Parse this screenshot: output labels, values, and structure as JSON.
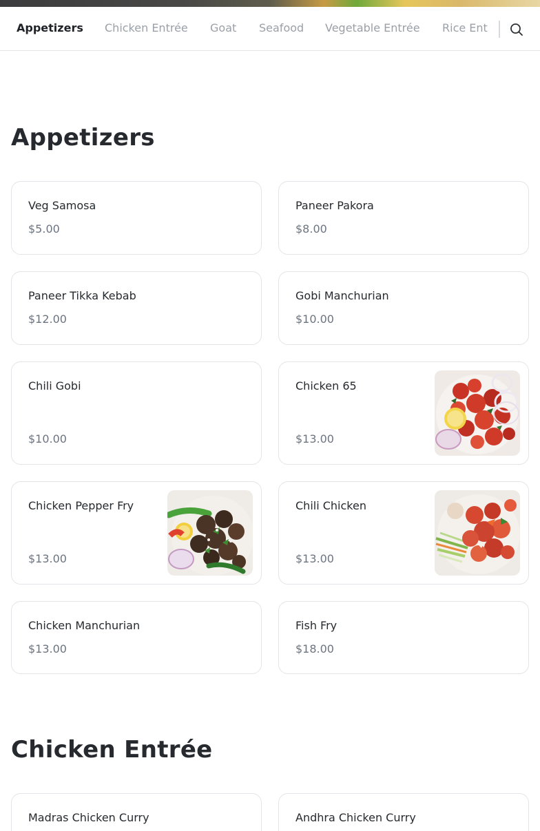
{
  "nav": {
    "tabs": [
      {
        "label": "Appetizers",
        "active": true
      },
      {
        "label": "Chicken Entrée",
        "active": false
      },
      {
        "label": "Goat",
        "active": false
      },
      {
        "label": "Seafood",
        "active": false
      },
      {
        "label": "Vegetable Entrée",
        "active": false
      },
      {
        "label": "Rice Ent",
        "active": false
      }
    ],
    "search_icon": "search-icon"
  },
  "sections": [
    {
      "title": "Appetizers",
      "items": [
        {
          "name": "Veg Samosa",
          "price": "$5.00",
          "image": null
        },
        {
          "name": "Paneer Pakora",
          "price": "$8.00",
          "image": null
        },
        {
          "name": "Paneer Tikka Kebab",
          "price": "$12.00",
          "image": null
        },
        {
          "name": "Gobi Manchurian",
          "price": "$10.00",
          "image": null
        },
        {
          "name": "Chili Gobi",
          "price": "$10.00",
          "image": null
        },
        {
          "name": "Chicken 65",
          "price": "$13.00",
          "image": "chicken-65-photo"
        },
        {
          "name": "Chicken Pepper Fry",
          "price": "$13.00",
          "image": "chicken-pepper-fry-photo"
        },
        {
          "name": "Chili Chicken",
          "price": "$13.00",
          "image": "chili-chicken-photo"
        },
        {
          "name": "Chicken Manchurian",
          "price": "$13.00",
          "image": null
        },
        {
          "name": "Fish Fry",
          "price": "$18.00",
          "image": null
        }
      ]
    },
    {
      "title": "Chicken Entrée",
      "items": [
        {
          "name": "Madras Chicken Curry",
          "price": "",
          "image": null
        },
        {
          "name": "Andhra Chicken Curry",
          "price": "",
          "image": null
        }
      ]
    }
  ],
  "colors": {
    "accent_text": "#1f2328",
    "muted_text": "#9aa0a8",
    "price_text": "#6c7480",
    "card_border": "#e2e4e8"
  }
}
